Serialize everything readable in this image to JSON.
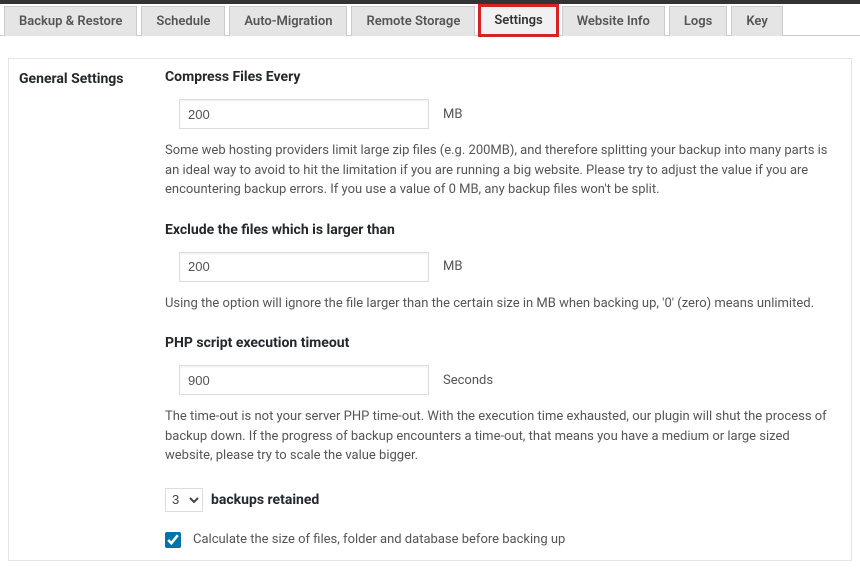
{
  "tabs": [
    {
      "label": "Backup & Restore"
    },
    {
      "label": "Schedule"
    },
    {
      "label": "Auto-Migration"
    },
    {
      "label": "Remote Storage"
    },
    {
      "label": "Settings"
    },
    {
      "label": "Website Info"
    },
    {
      "label": "Logs"
    },
    {
      "label": "Key"
    }
  ],
  "activeTabIndex": 4,
  "sidebar": {
    "title": "General Settings"
  },
  "fields": {
    "compress": {
      "label": "Compress Files Every",
      "value": "200",
      "unit": "MB",
      "desc": "Some web hosting providers limit large zip files (e.g. 200MB), and therefore splitting your backup into many parts is an ideal way to avoid to hit the limitation if you are running a big website. Please try to adjust the value if you are encountering backup errors. If you use a value of 0 MB, any backup files won't be split."
    },
    "exclude": {
      "label": "Exclude the files which is larger than",
      "value": "200",
      "unit": "MB",
      "desc": "Using the option will ignore the file larger than the certain size in MB when backing up, '0' (zero) means unlimited."
    },
    "timeout": {
      "label": "PHP script execution timeout",
      "value": "900",
      "unit": "Seconds",
      "desc": "The time-out is not your server PHP time-out. With the execution time exhausted, our plugin will shut the process of backup down. If the progress of backup encounters a time-out, that means you have a medium or large sized website, please try to scale the value bigger."
    },
    "retain": {
      "value": "3",
      "label": "backups retained"
    },
    "calcSize": {
      "checked": true,
      "label": "Calculate the size of files, folder and database before backing up"
    }
  }
}
